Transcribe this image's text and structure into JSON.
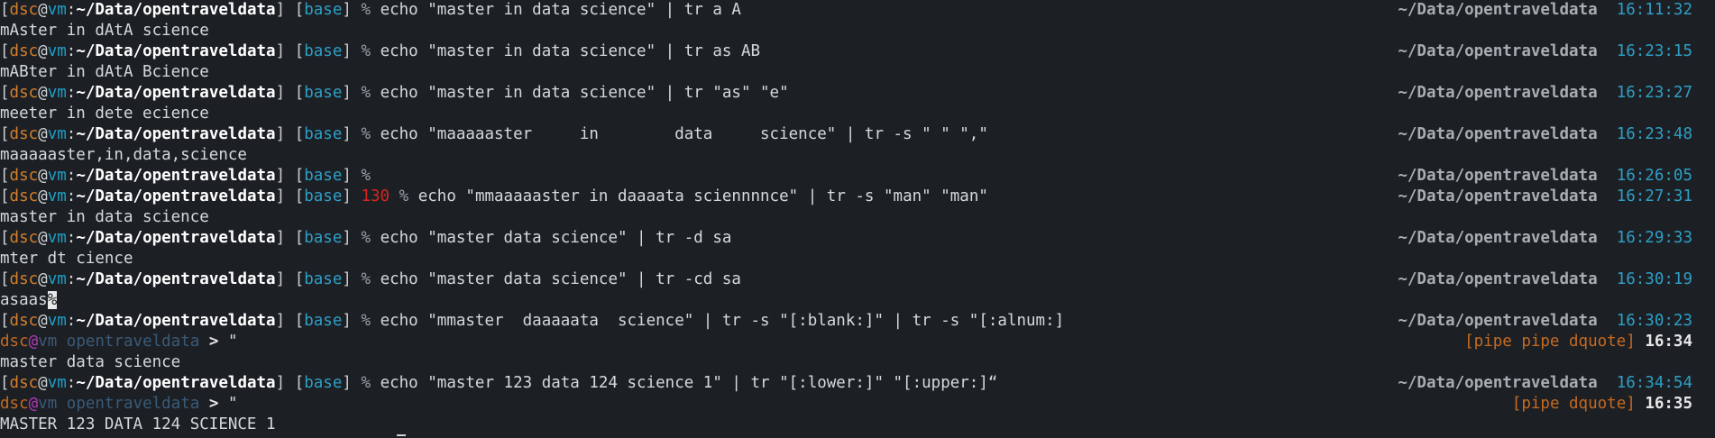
{
  "colors": {
    "background": "#1c2025",
    "user": "#d37f2d",
    "host": "#1e9fc8",
    "path": "#ffffff",
    "env": "#2f9ec5",
    "error": "#d7261e",
    "time": "#2f9ec5"
  },
  "prompt": {
    "user": "dsc",
    "at": "@",
    "host": "vm",
    "colon": ":",
    "path": "~/Data/opentraveldata",
    "env": "base",
    "symbol": "%",
    "rpath": "~/Data/opentraveldata",
    "bracket_open": "[",
    "bracket_close": "]"
  },
  "pipe_prompt": {
    "user": "dsc",
    "at": "@",
    "host": "vm",
    "dir": "opentraveldata",
    "arrow": ">",
    "quote": "\""
  },
  "entries": [
    {
      "command": "echo \"master in data science\" | tr a A",
      "time": "16:11:32",
      "output": "mAster in dAtA science"
    },
    {
      "command": "echo \"master in data science\" | tr as AB",
      "time": "16:23:15",
      "output": "mABter in dAtA Bcience"
    },
    {
      "command": "echo \"master in data science\" | tr \"as\" \"e\"",
      "time": "16:23:27",
      "output": "meeter in dete ecience"
    },
    {
      "command": "echo \"maaaaaster     in        data     science\" | tr -s \" \" \",\"",
      "time": "16:23:48",
      "output": "maaaaaster,in,data,science"
    },
    {
      "command": "",
      "time": "16:26:05"
    },
    {
      "status": "130",
      "command": "echo \"mmaaaaaster in daaaata sciennnnce\" | tr -s \"man\" \"man\"",
      "time": "16:27:31",
      "output": "master in data science"
    },
    {
      "command": "echo \"master data science\" | tr -d sa",
      "time": "16:29:33",
      "output": "mter dt cience"
    },
    {
      "command": "echo \"master data science\" | tr -cd sa",
      "time": "16:30:19",
      "output": "asaas",
      "output_mark": "%"
    },
    {
      "command": "echo \"mmaster  daaaaata  science\" | tr -s \"[:blank:]\" | tr -s \"[:alnum:]",
      "time": "16:30:23",
      "pipe_status": "[pipe pipe dquote]",
      "pipe_time": "16:34",
      "output": "master data science"
    },
    {
      "command": "echo \"master 123 data 124 science 1\" | tr \"[:lower:]\" \"[:upper:]“",
      "time": "16:34:54",
      "pipe_status": "[pipe dquote]",
      "pipe_time": "16:35",
      "output": "MASTER 123 DATA 124 SCIENCE 1"
    }
  ]
}
